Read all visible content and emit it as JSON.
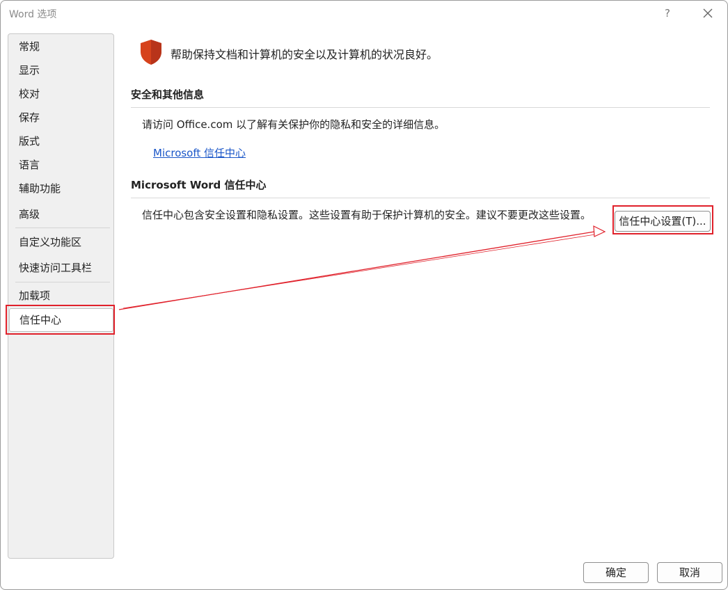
{
  "window": {
    "title": "Word 选项",
    "help_label": "?"
  },
  "nav": {
    "items": [
      {
        "label": "常规"
      },
      {
        "label": "显示"
      },
      {
        "label": "校对"
      },
      {
        "label": "保存"
      },
      {
        "label": "版式"
      },
      {
        "label": "语言"
      },
      {
        "label": "辅助功能"
      },
      {
        "label": "高级"
      },
      {
        "label": "自定义功能区"
      },
      {
        "label": "快速访问工具栏"
      },
      {
        "label": "加载项"
      },
      {
        "label": "信任中心"
      }
    ],
    "selected": "信任中心"
  },
  "main": {
    "header_text": "帮助保持文档和计算机的安全以及计算机的状况良好。",
    "security_section": {
      "title": "安全和其他信息",
      "text": "请访问 Office.com 以了解有关保护你的隐私和安全的详细信息。",
      "link": "Microsoft 信任中心"
    },
    "trust_center_section": {
      "title": "Microsoft Word 信任中心",
      "text": "信任中心包含安全设置和隐私设置。这些设置有助于保护计算机的安全。建议不要更改这些设置。",
      "button_label": "信任中心设置(T)..."
    }
  },
  "footer": {
    "ok_label": "确定",
    "cancel_label": "取消"
  },
  "colors": {
    "accent": "#1a56c8",
    "shield": "#d6421c",
    "annotation": "#e0202a"
  }
}
